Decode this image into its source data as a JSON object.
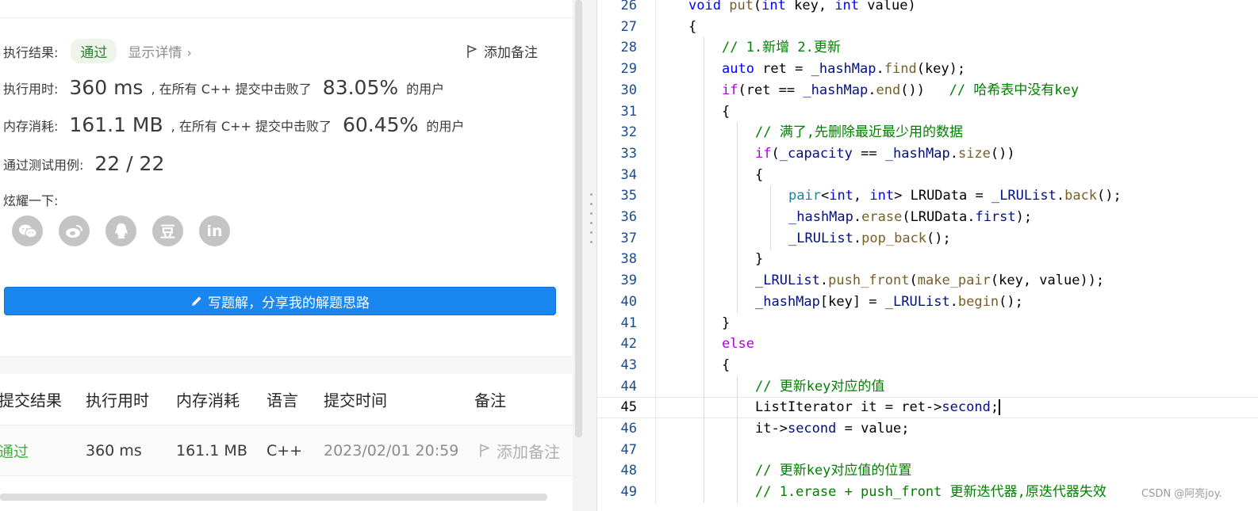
{
  "result": {
    "label": "执行结果:",
    "status": "通过",
    "details": "显示详情",
    "details_chevron": "›",
    "note": "添加备注",
    "time_label": "执行用时:",
    "time_value": "360 ms",
    "time_text": ", 在所有 C++ 提交中击败了",
    "time_pct": "83.05%",
    "time_suffix": "的用户",
    "mem_label": "内存消耗:",
    "mem_value": "161.1 MB",
    "mem_text": ", 在所有 C++ 提交中击败了",
    "mem_pct": "60.45%",
    "mem_suffix": "的用户",
    "tests_label": "通过测试用例:",
    "tests_value": "22 / 22",
    "share_label": "炫耀一下:",
    "share_icons": [
      "wechat-icon",
      "weibo-icon",
      "qq-icon",
      "douban-icon",
      "linkedin-icon"
    ],
    "douban_glyph": "豆",
    "linkedin_glyph": "in",
    "write_button": "写题解，分享我的解题思路"
  },
  "table": {
    "headers": [
      "提交结果",
      "执行用时",
      "内存消耗",
      "语言",
      "提交时间",
      "备注"
    ],
    "rows": [
      {
        "status": "通过",
        "time": "360 ms",
        "memory": "161.1 MB",
        "lang": "C++",
        "submitted": "2023/02/01 20:59",
        "note": "添加备注"
      }
    ]
  },
  "editor": {
    "current_line": 45,
    "lines": [
      {
        "n": "26",
        "text": "void put(int key, int value)"
      },
      {
        "n": "27",
        "text": "{"
      },
      {
        "n": "28",
        "text": "// 1.新增 2.更新"
      },
      {
        "n": "29",
        "text": "auto ret = _hashMap.find(key);"
      },
      {
        "n": "30",
        "text": "if(ret == _hashMap.end())   // 哈希表中没有key"
      },
      {
        "n": "31",
        "text": "{"
      },
      {
        "n": "32",
        "text": "// 满了,先删除最近最少用的数据"
      },
      {
        "n": "33",
        "text": "if(_capacity == _hashMap.size())"
      },
      {
        "n": "34",
        "text": "{"
      },
      {
        "n": "35",
        "text": "pair<int, int> LRUData = _LRUList.back();"
      },
      {
        "n": "36",
        "text": "_hashMap.erase(LRUData.first);"
      },
      {
        "n": "37",
        "text": "_LRUList.pop_back();"
      },
      {
        "n": "38",
        "text": "}"
      },
      {
        "n": "39",
        "text": "_LRUList.push_front(make_pair(key, value));"
      },
      {
        "n": "40",
        "text": "_hashMap[key] = _LRUList.begin();"
      },
      {
        "n": "41",
        "text": "}"
      },
      {
        "n": "42",
        "text": "else"
      },
      {
        "n": "43",
        "text": "{"
      },
      {
        "n": "44",
        "text": "// 更新key对应的值"
      },
      {
        "n": "45",
        "text": "ListIterator it = ret->second;"
      },
      {
        "n": "46",
        "text": "it->second = value;"
      },
      {
        "n": "47",
        "text": ""
      },
      {
        "n": "48",
        "text": "// 更新key对应值的位置"
      },
      {
        "n": "49",
        "text": "// 1.erase + push_front 更新迭代器,原迭代器失效"
      }
    ]
  },
  "watermark": "CSDN @阿亮joy.",
  "colors": {
    "pass_green": "#3fb33f",
    "button_blue": "#1a86f0",
    "keyword": "#0000ff",
    "control": "#af00db",
    "function": "#795e26",
    "class": "#267f99",
    "variable": "#001080",
    "comment": "#008000",
    "line_number": "#1d4b8a"
  }
}
